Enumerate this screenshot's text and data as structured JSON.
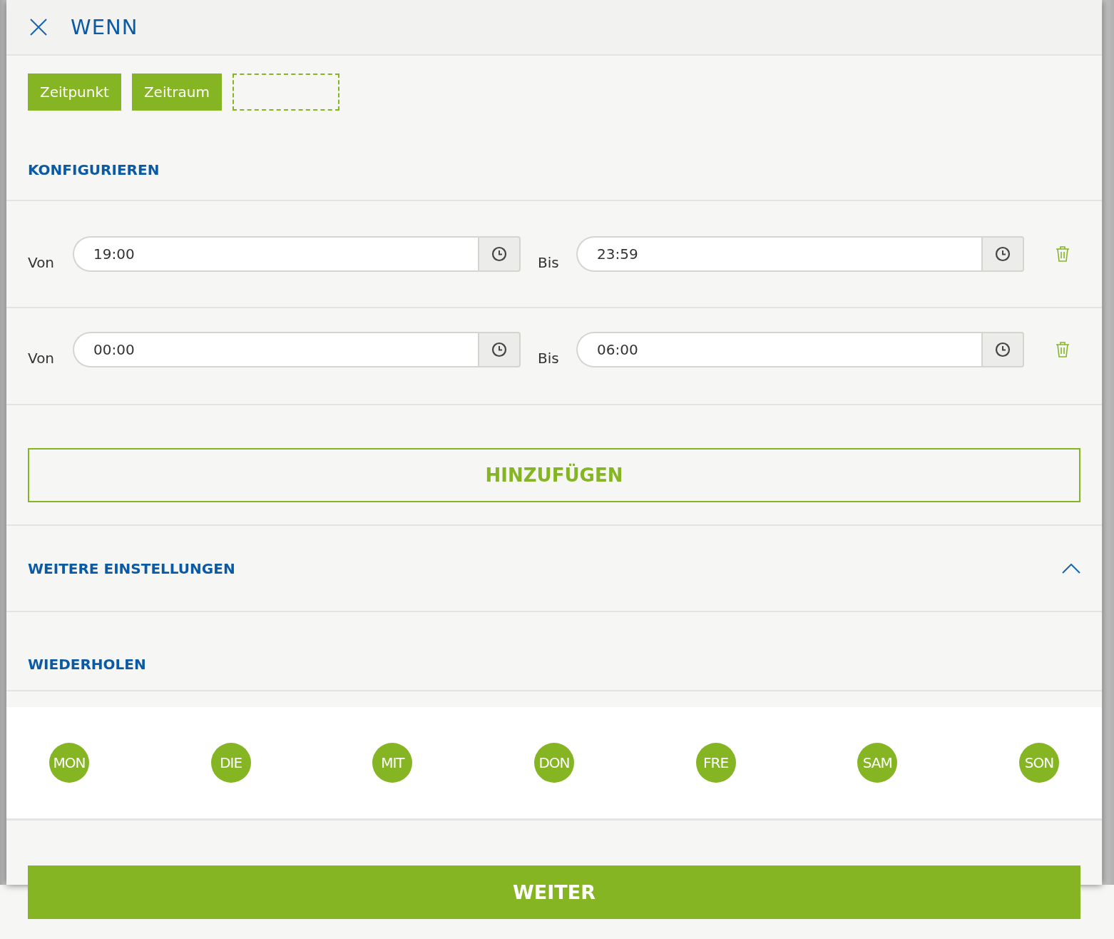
{
  "header": {
    "title": "WENN"
  },
  "tabs": [
    {
      "label": "Zeitpunkt"
    },
    {
      "label": "Zeitraum"
    }
  ],
  "configure": {
    "heading": "KONFIGURIEREN"
  },
  "ranges": [
    {
      "from_label": "Von",
      "from": "19:00",
      "to_label": "Bis",
      "to": "23:59"
    },
    {
      "from_label": "Von",
      "from": "00:00",
      "to_label": "Bis",
      "to": "06:00"
    }
  ],
  "add_button": "HINZUFÜGEN",
  "more_settings": {
    "heading": "WEITERE EINSTELLUNGEN",
    "expanded": true
  },
  "repeat": {
    "heading": "WIEDERHOLEN"
  },
  "days": [
    {
      "label": "MON",
      "selected": true
    },
    {
      "label": "DIE",
      "selected": true
    },
    {
      "label": "MIT",
      "selected": true
    },
    {
      "label": "DON",
      "selected": true
    },
    {
      "label": "FRE",
      "selected": true
    },
    {
      "label": "SAM",
      "selected": true
    },
    {
      "label": "SON",
      "selected": true
    }
  ],
  "next_button": "WEITER"
}
